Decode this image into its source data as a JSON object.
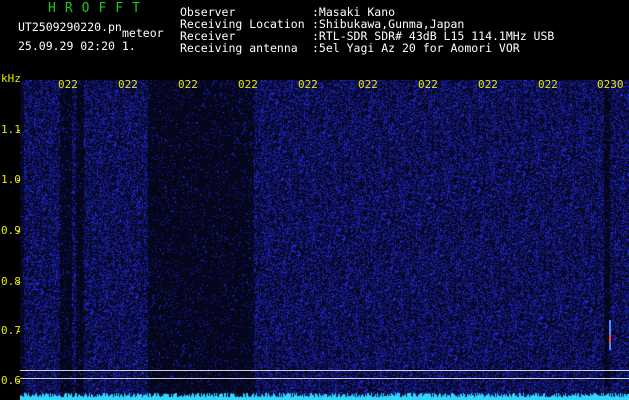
{
  "header": {
    "app_title": "HROFFT",
    "file_name": "UT2509290220.pn",
    "meteor_type": "meteor",
    "timestamp": "25.09.29 02:20    1.",
    "info": [
      {
        "label": "Observer",
        "value": ":Masaki Kano"
      },
      {
        "label": "Receiving Location",
        "value": ":Shibukawa,Gunma,Japan"
      },
      {
        "label": "Receiver",
        "value": ":RTL-SDR SDR# 43dB L15 114.1MHz USB"
      },
      {
        "label": "Receiving antenna",
        "value": ":5el Yagi Az 20 for Aomori VOR"
      }
    ]
  },
  "spectrogram": {
    "y_unit": "kHz",
    "y_ticks": [
      "1.1",
      "1.0",
      "0.9",
      "0.8",
      "0.7",
      "0.6"
    ],
    "x_ticks": [
      "022",
      "022",
      "022",
      "022",
      "022",
      "022",
      "022",
      "022",
      "022",
      "0230"
    ],
    "colors": {
      "background": "#05051c",
      "noise": "#2a3cff",
      "baseline": "#33d6ff",
      "axis_text": "#e8e800"
    }
  }
}
